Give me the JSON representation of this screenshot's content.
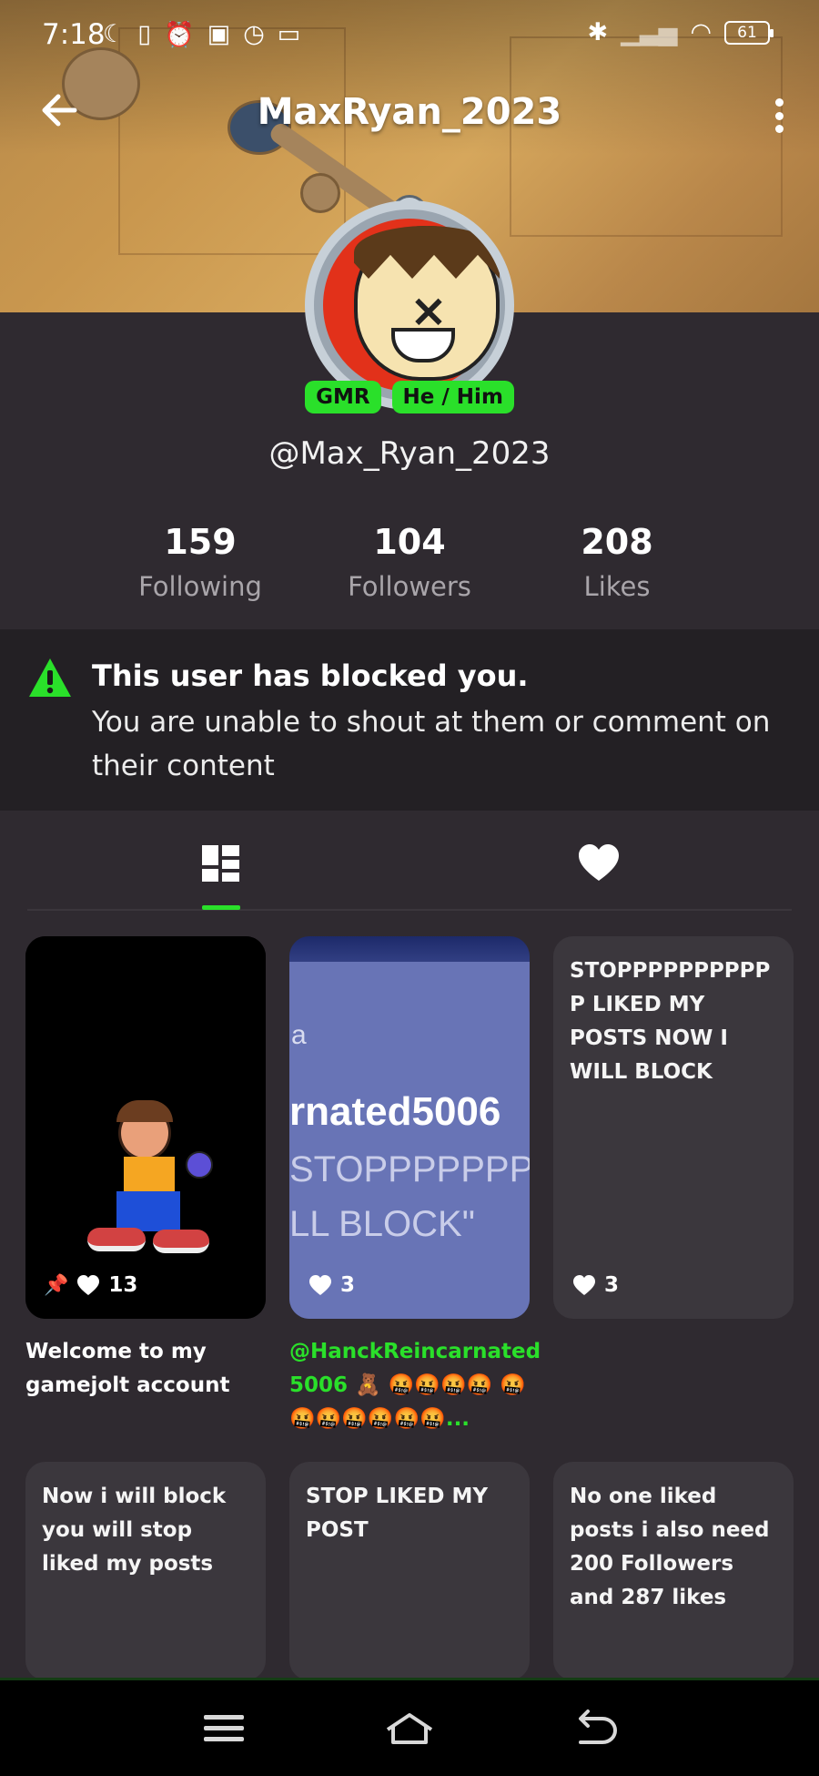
{
  "status_bar": {
    "time": "7:18",
    "battery": "61"
  },
  "header": {
    "title": "MaxRyan_2023"
  },
  "profile": {
    "badges": [
      "GMR",
      "He / Him"
    ],
    "handle": "@Max_Ryan_2023",
    "stats": [
      {
        "value": "159",
        "label": "Following"
      },
      {
        "value": "104",
        "label": "Followers"
      },
      {
        "value": "208",
        "label": "Likes"
      }
    ]
  },
  "notice": {
    "title": "This user has blocked you.",
    "body": "You are unable to shout at them or comment on their content"
  },
  "tabs": [
    {
      "icon": "grid-icon",
      "active": true
    },
    {
      "icon": "heart-icon",
      "active": false
    }
  ],
  "posts": [
    {
      "kind": "image",
      "likes": "13",
      "pinned": true,
      "caption": "Welcome to my gamejolt account"
    },
    {
      "kind": "image",
      "likes": "3",
      "image_lines": [
        "a",
        "rnated5006",
        "STOPPPPPPPPI",
        "LL BLOCK\""
      ],
      "caption_mention": "@HanckReincarnated",
      "caption_rest": "5006 🧸 🤬🤬🤬🤬 🤬🤬🤬🤬🤬🤬🤬..."
    },
    {
      "kind": "text",
      "text": "STOPPPPPPPPPP P LIKED MY POSTS NOW I WILL BLOCK",
      "likes": "3"
    },
    {
      "kind": "text",
      "text": "Now i will block you will stop liked my posts"
    },
    {
      "kind": "text",
      "text": "STOP LIKED MY POST"
    },
    {
      "kind": "text",
      "text": "No one liked posts i also need 200 Followers and 287 likes"
    }
  ],
  "colors": {
    "accent": "#2ae02a",
    "background": "#2f2a30",
    "card": "#3b373d",
    "notice_bg": "#232024"
  }
}
